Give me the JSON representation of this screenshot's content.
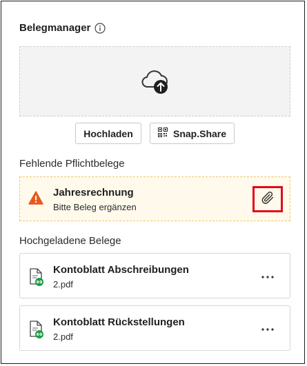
{
  "header": {
    "title": "Belegmanager",
    "info_icon": "info-icon"
  },
  "upload": {
    "icon": "cloud-upload-icon",
    "upload_label": "Hochladen",
    "snap_label": "Snap.Share",
    "snap_icon": "qr-code-icon"
  },
  "missing": {
    "section_title": "Fehlende Pflichtbelege",
    "items": [
      {
        "title": "Jahresrechnung",
        "subtitle": "Bitte Beleg ergänzen",
        "icon": "warning-icon",
        "action_icon": "paperclip-icon"
      }
    ]
  },
  "uploaded": {
    "section_title": "Hochgeladene Belege",
    "items": [
      {
        "title": "Kontoblatt Abschreibungen",
        "subtitle": "2.pdf",
        "icon": "document-linked-icon",
        "menu_icon": "more-options-icon"
      },
      {
        "title": "Kontoblatt Rückstellungen",
        "subtitle": "2.pdf",
        "icon": "document-linked-icon",
        "menu_icon": "more-options-icon"
      }
    ]
  },
  "colors": {
    "warning": "#e8591a",
    "highlight": "#e0081a",
    "link_badge": "#1f9d4a",
    "missing_bg": "#fffaeb",
    "dropzone_bg": "#f3f3f3"
  }
}
